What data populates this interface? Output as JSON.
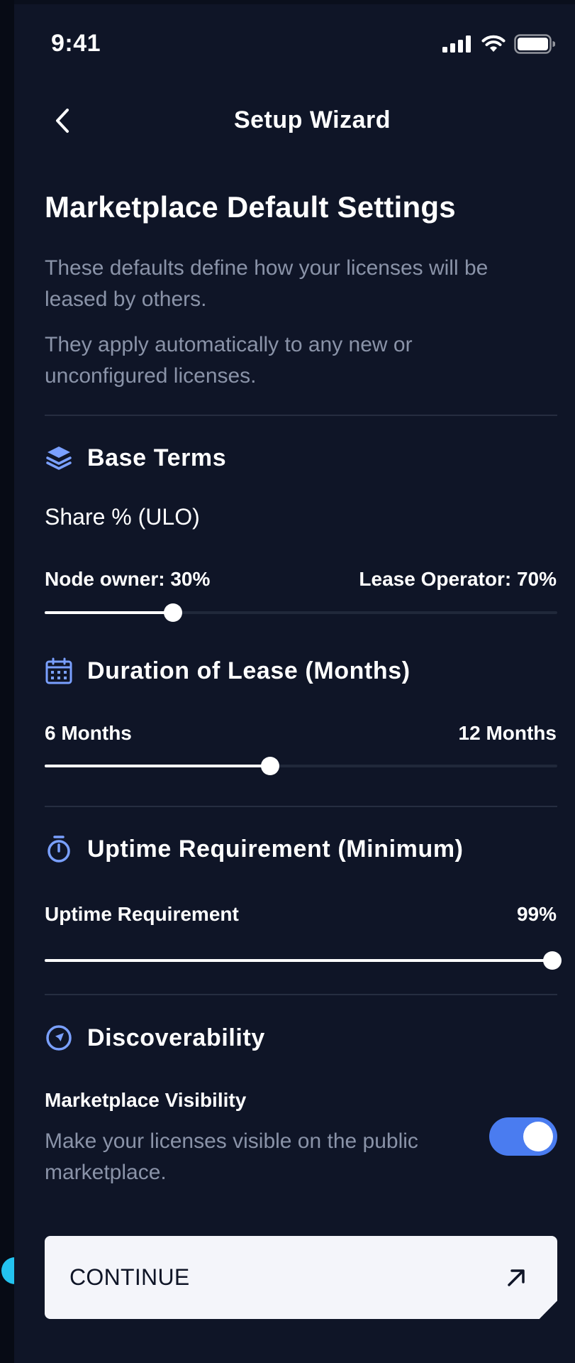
{
  "status_bar": {
    "time": "9:41"
  },
  "header": {
    "title": "Setup Wizard"
  },
  "page": {
    "title": "Marketplace Default Settings",
    "desc1": "These defaults define how your licenses will be leased by others.",
    "desc2": "They apply automatically to any new or unconfigured licenses."
  },
  "base_terms": {
    "title": "Base Terms",
    "share_label": "Share % (ULO)",
    "left_label": "Node owner: 30%",
    "right_label": "Lease Operator: 70%",
    "slider_value": 0.25
  },
  "duration": {
    "title": "Duration of Lease (Months)",
    "left_label": "6 Months",
    "right_label": "12 Months",
    "slider_value": 0.44
  },
  "uptime": {
    "title": "Uptime Requirement (Minimum)",
    "label": "Uptime Requirement",
    "value_text": "99%",
    "slider_value": 0.99
  },
  "discoverability": {
    "title": "Discoverability",
    "visibility_label": "Marketplace Visibility",
    "visibility_desc": "Make your licenses visible on the public marketplace.",
    "toggle_on": true
  },
  "footer": {
    "continue_label": "CONTINUE"
  },
  "colors": {
    "accent": "#4a7cf0",
    "icon_blue": "#7aa0ff",
    "dot": "#23c3f0",
    "bg": "#0f1527"
  }
}
